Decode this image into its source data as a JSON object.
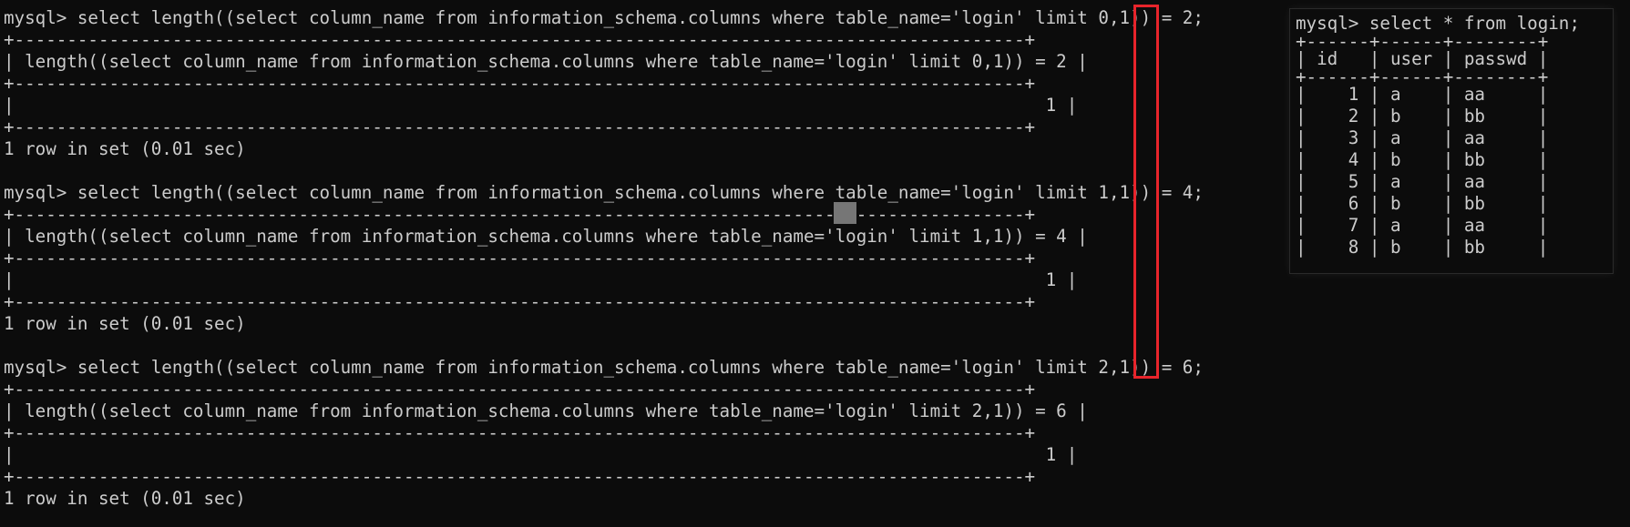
{
  "terminal": {
    "blocks": [
      {
        "command": "mysql> select length((select column_name from information_schema.columns where table_name='login' limit 0,1)) = 2;",
        "border": "+------------------------------------------------------------------------------------------------+",
        "header": "| length((select column_name from information_schema.columns where table_name='login' limit 0,1)) = 2 |",
        "value": "|                                                                                                  1 |",
        "status": "1 row in set (0.01 sec)"
      },
      {
        "command": "mysql> select length((select column_name from information_schema.columns where table_name='login' limit 1,1)) = 4;",
        "border": "+------------------------------------------------------------------------------------------------+",
        "header": "| length((select column_name from information_schema.columns where table_name='login' limit 1,1)) = 4 |",
        "value": "|                                                                                                  1 |",
        "status": "1 row in set (0.01 sec)"
      },
      {
        "command": "mysql> select length((select column_name from information_schema.columns where table_name='login' limit 2,1)) = 6;",
        "border": "+------------------------------------------------------------------------------------------------+",
        "header": "| length((select column_name from information_schema.columns where table_name='login' limit 2,1)) = 6 |",
        "value": "|                                                                                                  1 |",
        "status": "1 row in set (0.01 sec)"
      }
    ]
  },
  "side_panel": {
    "command": "mysql> select * from login;",
    "border": "+------+------+--------+",
    "header": "| id   | user | passwd |",
    "rows": [
      "|    1 | a    | aa     |",
      "|    2 | b    | bb     |",
      "|    3 | a    | aa     |",
      "|    4 | b    | bb     |",
      "|    5 | a    | aa     |",
      "|    6 | b    | bb     |",
      "|    7 | a    | aa     |",
      "|    8 | b    | bb     |"
    ]
  },
  "colors": {
    "background": "#0c0c0c",
    "text": "#cccccc",
    "highlight": "#e8242b",
    "cursor": "#767676"
  }
}
